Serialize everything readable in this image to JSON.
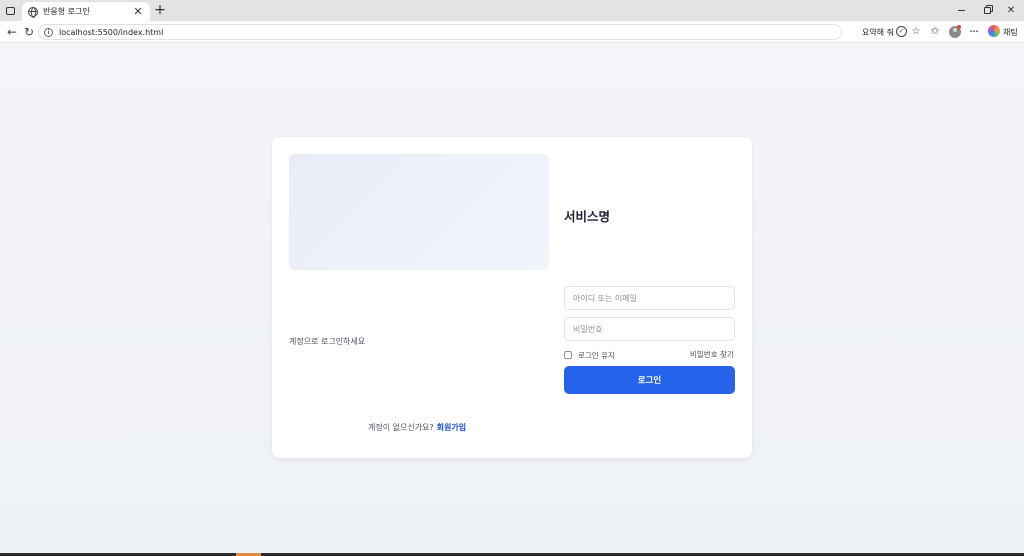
{
  "browser": {
    "tab_title": "반응형 로그인",
    "tab_close": "✕",
    "new_tab": "+",
    "url": "localhost:5500/index.html",
    "summary_label": "요약해 줘",
    "copilot_label": "채팅",
    "more": "···"
  },
  "login": {
    "service_name": "서비스명",
    "subtitle": "계정으로 로그인하세요",
    "id_placeholder": "아이디 또는 이메일",
    "password_placeholder": "비밀번호",
    "remember_label": "로그인 유지",
    "remember_checked": false,
    "find_password": "비밀번호 찾기",
    "submit_label": "로그인",
    "signup_prompt": "계정이 없으신가요?",
    "signup_link": "회원가입"
  },
  "colors": {
    "accent": "#2563eb",
    "link": "#1d4ed8",
    "page_bg": "#f1f3f7",
    "card_bg": "#ffffff"
  }
}
